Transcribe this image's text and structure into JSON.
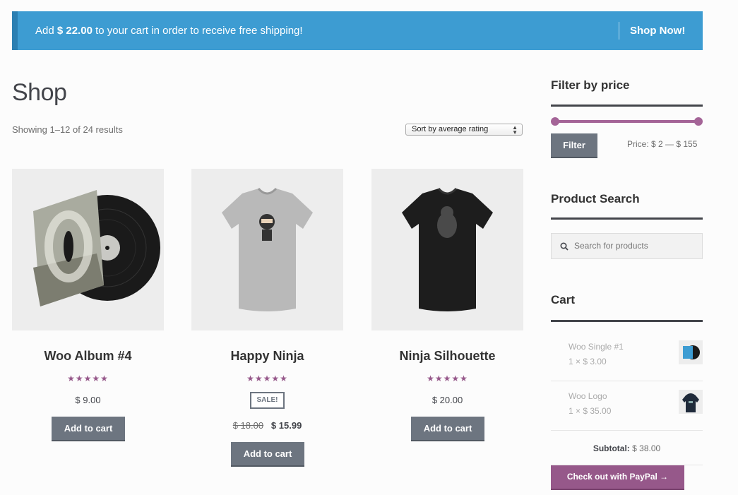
{
  "notice": {
    "prefix": "Add ",
    "amount": "$ 22.00",
    "suffix": " to your cart in order to receive free shipping!",
    "link": "Shop Now!"
  },
  "shop": {
    "title": "Shop",
    "result_count": "Showing 1–12 of 24 results",
    "orderby": "Sort by average rating"
  },
  "products": [
    {
      "title": "Woo Album #4",
      "rating_stars": "★★★★★",
      "rating": 5,
      "price": "$ 9.00",
      "button": "Add to cart",
      "image": "vinyl-album-cover"
    },
    {
      "title": "Happy Ninja",
      "rating_stars": "★★★★★",
      "rating": 5,
      "sale_badge": "SALE!",
      "old_price": "$ 18.00",
      "price": "$ 15.99",
      "button": "Add to cart",
      "image": "grey-ninja-tshirt"
    },
    {
      "title": "Ninja Silhouette",
      "rating_stars": "★★★★★",
      "rating": 5,
      "price": "$ 20.00",
      "button": "Add to cart",
      "image": "black-ninja-tshirt"
    }
  ],
  "sidebar": {
    "filter": {
      "title": "Filter by price",
      "button": "Filter",
      "price_label": "Price: $ 2 — $ 155",
      "min": 2,
      "max": 155
    },
    "search": {
      "title": "Product Search",
      "placeholder": "Search for products"
    },
    "cart": {
      "title": "Cart",
      "items": [
        {
          "name": "Woo Single #1",
          "qty": "1 × $ 3.00",
          "image": "woo-single-cover"
        },
        {
          "name": "Woo Logo",
          "qty": "1 × $ 35.00",
          "image": "woo-logo-hoodie"
        }
      ],
      "subtotal_label": "Subtotal:",
      "subtotal_value": " $ 38.00",
      "paypal": "Check out with PayPal →"
    }
  },
  "colors": {
    "notice_bg": "#3d9cd2",
    "accent_purple": "#96588a",
    "button_grey": "#6d7580"
  }
}
